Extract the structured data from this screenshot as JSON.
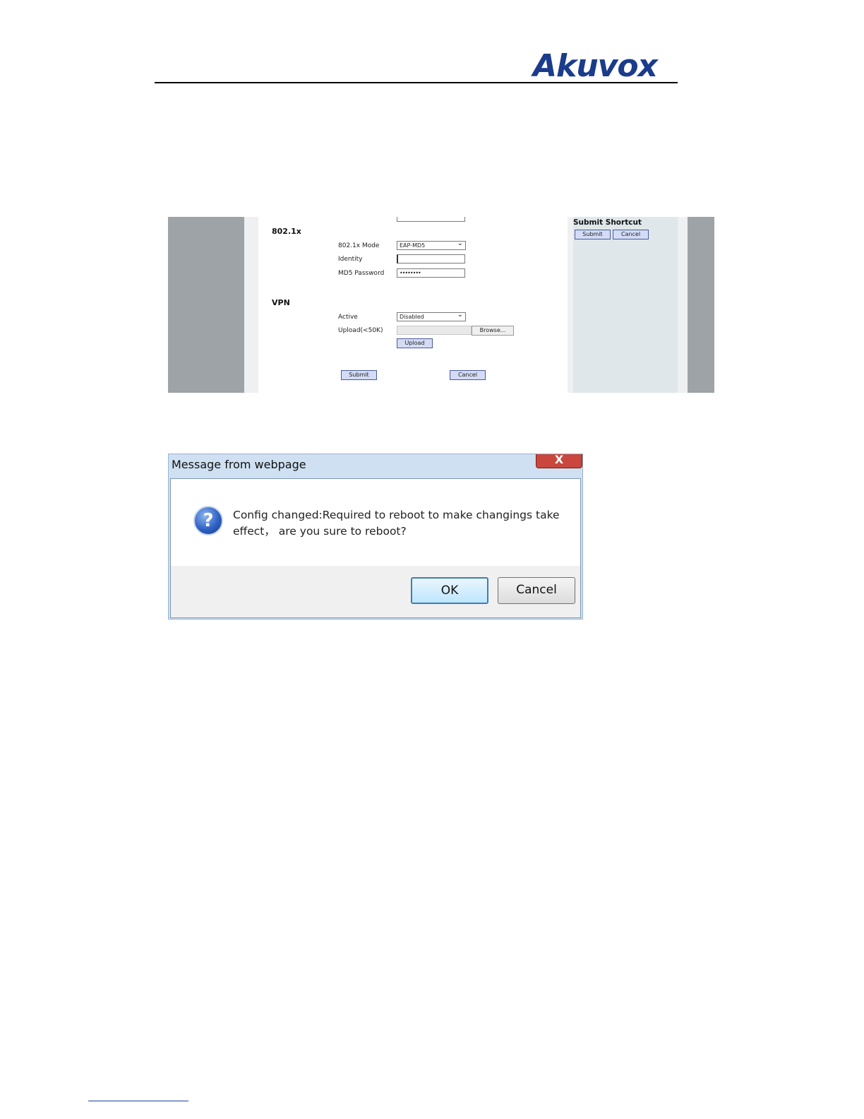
{
  "header": {
    "logo": "Akuvox"
  },
  "config_page": {
    "section_8021x": {
      "heading": "802.1x",
      "mode_label": "802.1x Mode",
      "mode_value": "EAP-MD5",
      "identity_label": "Identity",
      "identity_value": "",
      "password_label": "MD5 Password",
      "password_value": "••••••••"
    },
    "section_vpn": {
      "heading": "VPN",
      "active_label": "Active",
      "active_value": "Disabled",
      "upload_label": "Upload(<50K)",
      "browse_label": "Browse...",
      "upload_button": "Upload"
    },
    "submit_label": "Submit",
    "cancel_label": "Cancel",
    "shortcut": {
      "title": "Submit Shortcut",
      "submit_label": "Submit",
      "cancel_label": "Cancel"
    }
  },
  "dialog": {
    "title": "Message from webpage",
    "close_glyph": "X",
    "icon": "question-icon",
    "message": "Config changed:Required to reboot to make changings take effect， are you sure to reboot?",
    "ok_label": "OK",
    "cancel_label": "Cancel"
  }
}
